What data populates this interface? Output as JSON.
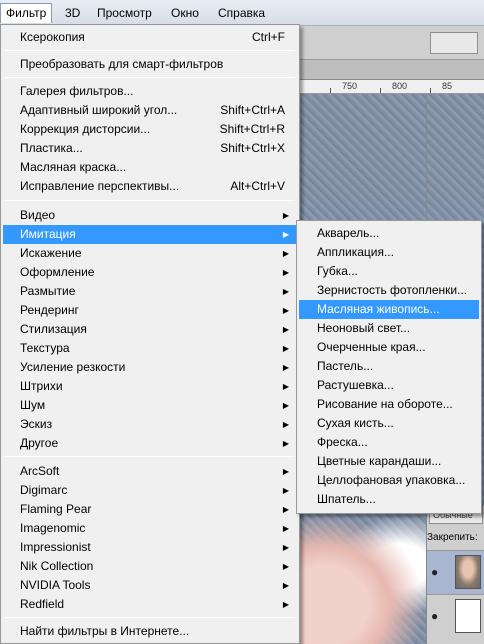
{
  "menubar": {
    "items": [
      {
        "label": "Фильтр",
        "active": true
      },
      {
        "label": "3D"
      },
      {
        "label": "Просмотр"
      },
      {
        "label": "Окно"
      },
      {
        "label": "Справка"
      }
    ]
  },
  "ruler": {
    "ticks": [
      "750",
      "800",
      "85"
    ]
  },
  "layers_panel": {
    "blend_mode": "Обычные",
    "lock_label": "Закрепить:"
  },
  "filter_menu": {
    "items": [
      {
        "label": "Ксерокопия",
        "shortcut": "Ctrl+F"
      },
      {
        "label": "Преобразовать для смарт-фильтров"
      },
      {
        "label": "Галерея фильтров..."
      },
      {
        "label": "Адаптивный широкий угол...",
        "shortcut": "Shift+Ctrl+A"
      },
      {
        "label": "Коррекция дисторсии...",
        "shortcut": "Shift+Ctrl+R"
      },
      {
        "label": "Пластика...",
        "shortcut": "Shift+Ctrl+X"
      },
      {
        "label": "Масляная краска..."
      },
      {
        "label": "Исправление перспективы...",
        "shortcut": "Alt+Ctrl+V"
      },
      {
        "label": "Видео",
        "submenu": true
      },
      {
        "label": "Имитация",
        "submenu": true,
        "highlighted": true
      },
      {
        "label": "Искажение",
        "submenu": true
      },
      {
        "label": "Оформление",
        "submenu": true
      },
      {
        "label": "Размытие",
        "submenu": true
      },
      {
        "label": "Рендеринг",
        "submenu": true
      },
      {
        "label": "Стилизация",
        "submenu": true
      },
      {
        "label": "Текстура",
        "submenu": true
      },
      {
        "label": "Усиление резкости",
        "submenu": true
      },
      {
        "label": "Штрихи",
        "submenu": true
      },
      {
        "label": "Шум",
        "submenu": true
      },
      {
        "label": "Эскиз",
        "submenu": true
      },
      {
        "label": "Другое",
        "submenu": true
      },
      {
        "label": "ArcSoft",
        "submenu": true
      },
      {
        "label": "Digimarc",
        "submenu": true
      },
      {
        "label": "Flaming Pear",
        "submenu": true
      },
      {
        "label": "Imagenomic",
        "submenu": true
      },
      {
        "label": "Impressionist",
        "submenu": true
      },
      {
        "label": "Nik Collection",
        "submenu": true
      },
      {
        "label": "NVIDIA Tools",
        "submenu": true
      },
      {
        "label": "Redfield",
        "submenu": true
      },
      {
        "label": "Найти фильтры в Интернете..."
      }
    ]
  },
  "imitation_submenu": {
    "items": [
      {
        "label": "Акварель..."
      },
      {
        "label": "Аппликация..."
      },
      {
        "label": "Губка..."
      },
      {
        "label": "Зернистость фотопленки..."
      },
      {
        "label": "Масляная живопись...",
        "highlighted": true
      },
      {
        "label": "Неоновый свет..."
      },
      {
        "label": "Очерченные края..."
      },
      {
        "label": "Пастель..."
      },
      {
        "label": "Растушевка..."
      },
      {
        "label": "Рисование на обороте..."
      },
      {
        "label": "Сухая кисть..."
      },
      {
        "label": "Фреска..."
      },
      {
        "label": "Цветные карандаши..."
      },
      {
        "label": "Целлофановая упаковка..."
      },
      {
        "label": "Шпатель..."
      }
    ]
  },
  "colors": {
    "highlight": "#3399ff",
    "menu_bg": "#f0f0f0"
  }
}
